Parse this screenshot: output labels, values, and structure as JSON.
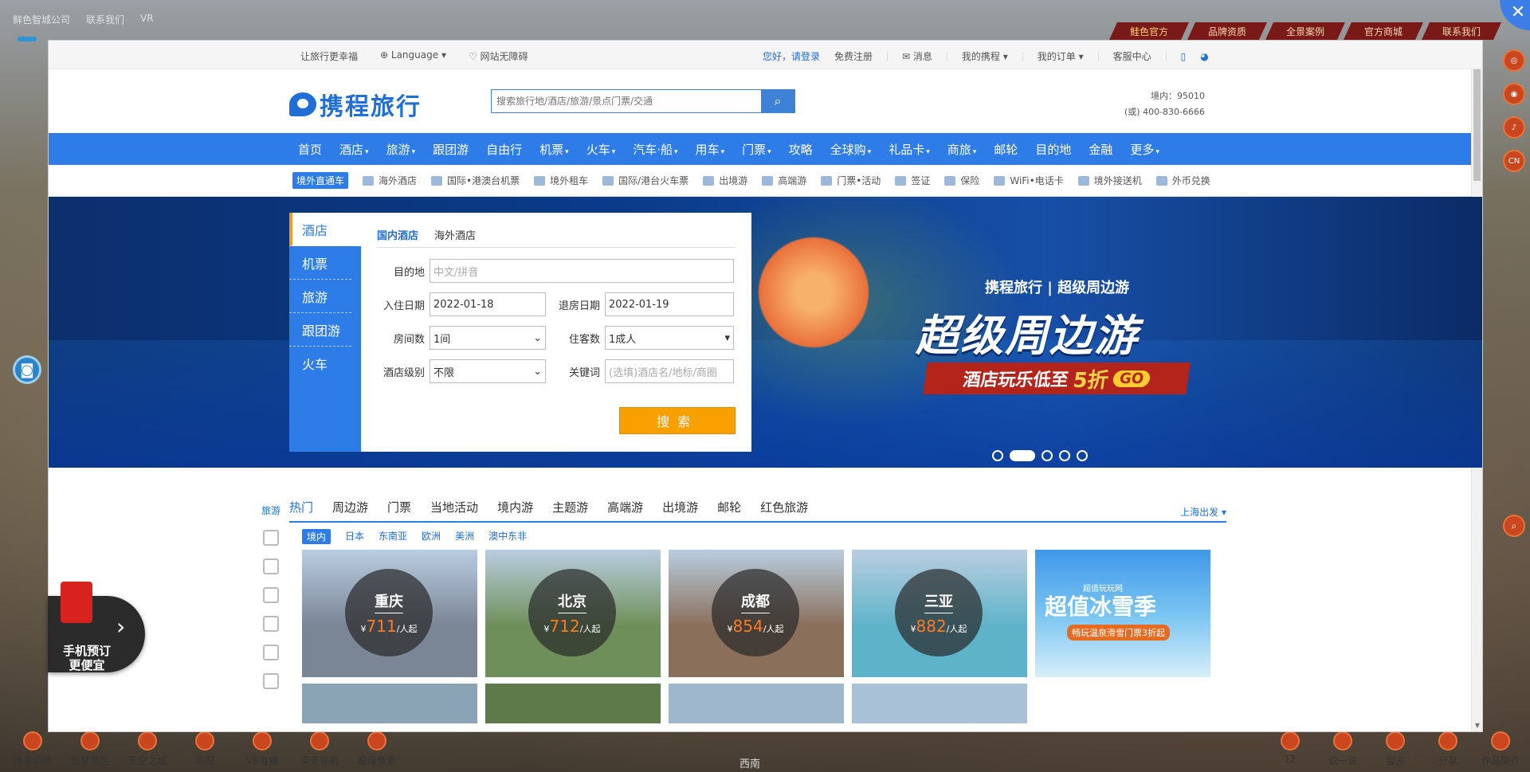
{
  "bg": {
    "top_links": [
      "鲜色智城公司",
      "联系我们",
      "VR"
    ],
    "brand_tabs": [
      "鲑色官方",
      "品牌资质",
      "全景案例",
      "官方商城",
      "联系我们"
    ],
    "close_icon": "close-icon",
    "bottom_left": [
      "场景切换",
      "智慧景区",
      "天空之城",
      "简图",
      "VR直播",
      "实景导航",
      "超级像素"
    ],
    "bottom_right": [
      "12",
      "说一说",
      "留言",
      "分享",
      "作品简介"
    ],
    "bottom_center": "西南",
    "side_right": [
      "",
      "",
      "",
      "CN"
    ]
  },
  "topbar": {
    "slogan": "让旅行更幸福",
    "language": "Language",
    "accessibility": "网站无障碍",
    "greeting": "您好，请登录",
    "register": "免费注册",
    "message": "消息",
    "my_trip": "我的携程",
    "my_order": "我的订单",
    "service": "客服中心"
  },
  "header": {
    "logo_text": "携程旅行",
    "search_placeholder": "搜索旅行地/酒店/旅游/景点门票/交通",
    "hotline_1": "境内：95010",
    "hotline_2": "(或) 400-830-6666"
  },
  "mainnav": [
    "首页",
    "酒店",
    "旅游",
    "跟团游",
    "自由行",
    "机票",
    "火车",
    "汽车·船",
    "用车",
    "门票",
    "攻略",
    "全球购",
    "礼品卡",
    "商旅",
    "邮轮",
    "目的地",
    "金融",
    "更多"
  ],
  "mainnav_arrows": [
    false,
    true,
    true,
    false,
    false,
    true,
    true,
    true,
    true,
    true,
    false,
    true,
    true,
    true,
    false,
    false,
    false,
    true
  ],
  "subnav": {
    "tag": "境外直通车",
    "items": [
      "海外酒店",
      "国际•港澳台机票",
      "境外租车",
      "国际/港台火车票",
      "出境游",
      "高端游",
      "门票•活动",
      "签证",
      "保险",
      "WiFi•电话卡",
      "境外接送机",
      "外币兑换"
    ]
  },
  "banner": {
    "brand": "携程旅行 | 超级周边游",
    "title": "超级周边游",
    "promo_a": "酒店玩乐低至",
    "promo_hl": "5折",
    "promo_go": "GO"
  },
  "booking": {
    "tabs": [
      "酒店",
      "机票",
      "旅游",
      "跟团游",
      "火车"
    ],
    "form_tabs": [
      "国内酒店",
      "海外酒店"
    ],
    "dest_label": "目的地",
    "dest_placeholder": "中文/拼音",
    "checkin_label": "入住日期",
    "checkin": "2022-01-18",
    "checkout_label": "退房日期",
    "checkout": "2022-01-19",
    "rooms_label": "房间数",
    "rooms": "1间",
    "guests_label": "住客数",
    "guests": "1成人",
    "level_label": "酒店级别",
    "level": "不限",
    "keyword_label": "关键词",
    "keyword_placeholder": "(选填)酒店名/地标/商圈",
    "search_btn": "搜索"
  },
  "travel": {
    "side_label": "旅游",
    "tabs": [
      "热门",
      "周边游",
      "门票",
      "当地活动",
      "境内游",
      "主题游",
      "高端游",
      "出境游",
      "邮轮",
      "红色旅游"
    ],
    "departure": "上海出发",
    "regions": [
      "境内",
      "日本",
      "东南亚",
      "欧洲",
      "美洲",
      "澳中东非"
    ],
    "cards": [
      {
        "city": "重庆",
        "price": "711",
        "unit": "/人起",
        "bg": "#7a8596"
      },
      {
        "city": "北京",
        "price": "712",
        "unit": "/人起",
        "bg": "#6f8f5a"
      },
      {
        "city": "成都",
        "price": "854",
        "unit": "/人起",
        "bg": "#8a6f5b"
      },
      {
        "city": "三亚",
        "price": "882",
        "unit": "/人起",
        "bg": "#5fb3c9"
      }
    ],
    "currency": "¥",
    "promo_card": {
      "small": "超值玩玩网",
      "title": "超值冰雪季",
      "sub": "畅玩温泉滑雪门票3折起"
    }
  },
  "redbag": {
    "line1": "手机预订",
    "line2": "更便宜"
  }
}
